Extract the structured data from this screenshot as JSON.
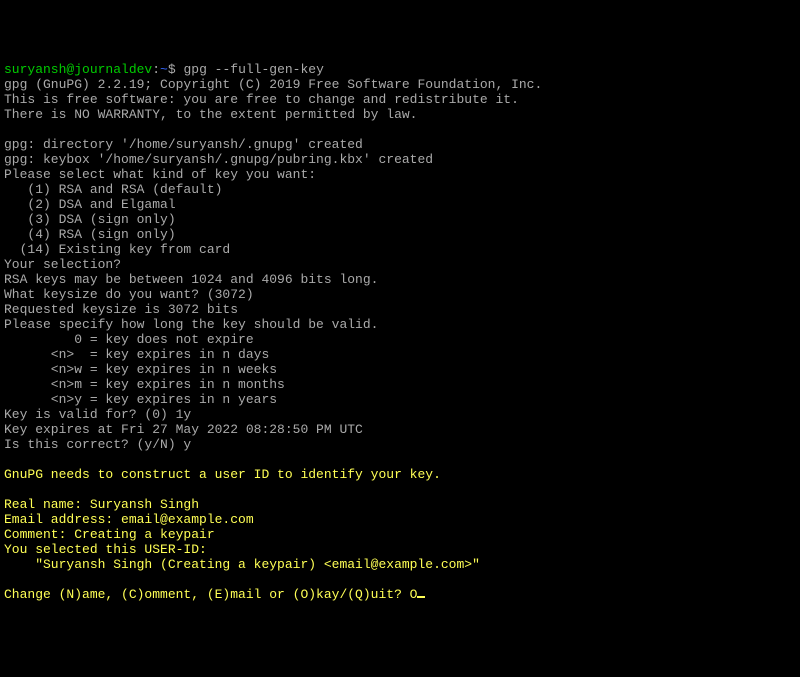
{
  "prompt": {
    "user": "suryansh@journaldev",
    "colon1": ":",
    "path": "~",
    "dollar": "$ ",
    "command": "gpg --full-gen-key"
  },
  "lines": [
    "gpg (GnuPG) 2.2.19; Copyright (C) 2019 Free Software Foundation, Inc.",
    "This is free software: you are free to change and redistribute it.",
    "There is NO WARRANTY, to the extent permitted by law.",
    "",
    "gpg: directory '/home/suryansh/.gnupg' created",
    "gpg: keybox '/home/suryansh/.gnupg/pubring.kbx' created",
    "Please select what kind of key you want:",
    "   (1) RSA and RSA (default)",
    "   (2) DSA and Elgamal",
    "   (3) DSA (sign only)",
    "   (4) RSA (sign only)",
    "  (14) Existing key from card",
    "Your selection?",
    "RSA keys may be between 1024 and 4096 bits long.",
    "What keysize do you want? (3072)",
    "Requested keysize is 3072 bits",
    "Please specify how long the key should be valid.",
    "         0 = key does not expire",
    "      <n>  = key expires in n days",
    "      <n>w = key expires in n weeks",
    "      <n>m = key expires in n months",
    "      <n>y = key expires in n years",
    "Key is valid for? (0) 1y",
    "Key expires at Fri 27 May 2022 08:28:50 PM UTC",
    "Is this correct? (y/N) y"
  ],
  "yellow_lines_1": [
    "",
    "GnuPG needs to construct a user ID to identify your key.",
    "",
    "Real name: Suryansh Singh",
    "Email address: email@example.com",
    "Comment: Creating a keypair",
    "You selected this USER-ID:",
    "    \"Suryansh Singh (Creating a keypair) <email@example.com>\"",
    ""
  ],
  "final_prompt": "Change (N)ame, (C)omment, (E)mail or (O)kay/(Q)uit? O"
}
